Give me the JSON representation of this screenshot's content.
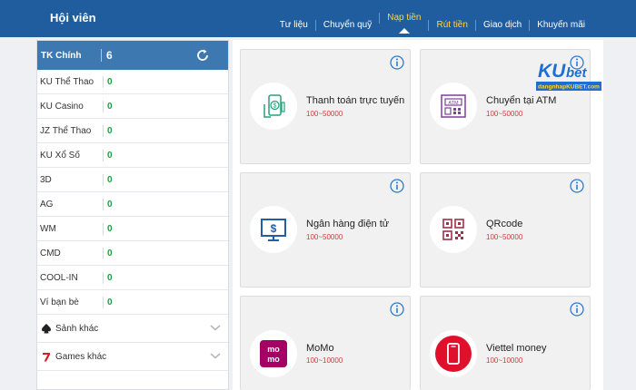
{
  "header": {
    "title": "Hội viên",
    "nav": [
      {
        "label": "Tư liệu",
        "style": "normal"
      },
      {
        "label": "Chuyển quỹ",
        "style": "normal"
      },
      {
        "label": "Nạp tiền",
        "style": "active"
      },
      {
        "label": "Rút tiền",
        "style": "yellow"
      },
      {
        "label": "Giao dịch",
        "style": "normal"
      },
      {
        "label": "Khuyến mãi",
        "style": "normal"
      }
    ]
  },
  "sidebar": {
    "main_account": {
      "label": "TK Chính",
      "value": "6"
    },
    "accounts": [
      {
        "label": "KU Thể Thao",
        "value": "0"
      },
      {
        "label": "KU Casino",
        "value": "0"
      },
      {
        "label": "JZ Thể Thao",
        "value": "0"
      },
      {
        "label": "KU Xổ Số",
        "value": "0"
      },
      {
        "label": "3D",
        "value": "0"
      },
      {
        "label": "AG",
        "value": "0"
      },
      {
        "label": "WM",
        "value": "0"
      },
      {
        "label": "CMD",
        "value": "0"
      },
      {
        "label": "COOL-IN",
        "value": "0"
      },
      {
        "label": "Ví bạn bè",
        "value": "0"
      }
    ],
    "groups": [
      {
        "label": "Sảnh khác",
        "icon": "spade-icon"
      },
      {
        "label": "Games khác",
        "icon": "seven-icon"
      }
    ]
  },
  "payments": [
    {
      "name": "Thanh toán trực tuyến",
      "range": "100~50000",
      "icon": "mobile-money-icon"
    },
    {
      "name": "Chuyển tại ATM",
      "range": "100~50000",
      "icon": "atm-icon"
    },
    {
      "name": "Ngân hàng điện tử",
      "range": "100~50000",
      "icon": "monitor-dollar-icon"
    },
    {
      "name": "QRcode",
      "range": "100~50000",
      "icon": "qrcode-icon"
    },
    {
      "name": "MoMo",
      "range": "100~10000",
      "icon": "momo-icon"
    },
    {
      "name": "Viettel money",
      "range": "100~10000",
      "icon": "viettel-icon"
    }
  ],
  "logo": {
    "brand": "KUbet",
    "caption": "dangnhapkubet.com"
  },
  "colors": {
    "header": "#1f5d9e",
    "accent": "#3d78b1",
    "positive": "#1aa23a",
    "range": "#d23a3a",
    "nav_active": "#ffd54a"
  }
}
